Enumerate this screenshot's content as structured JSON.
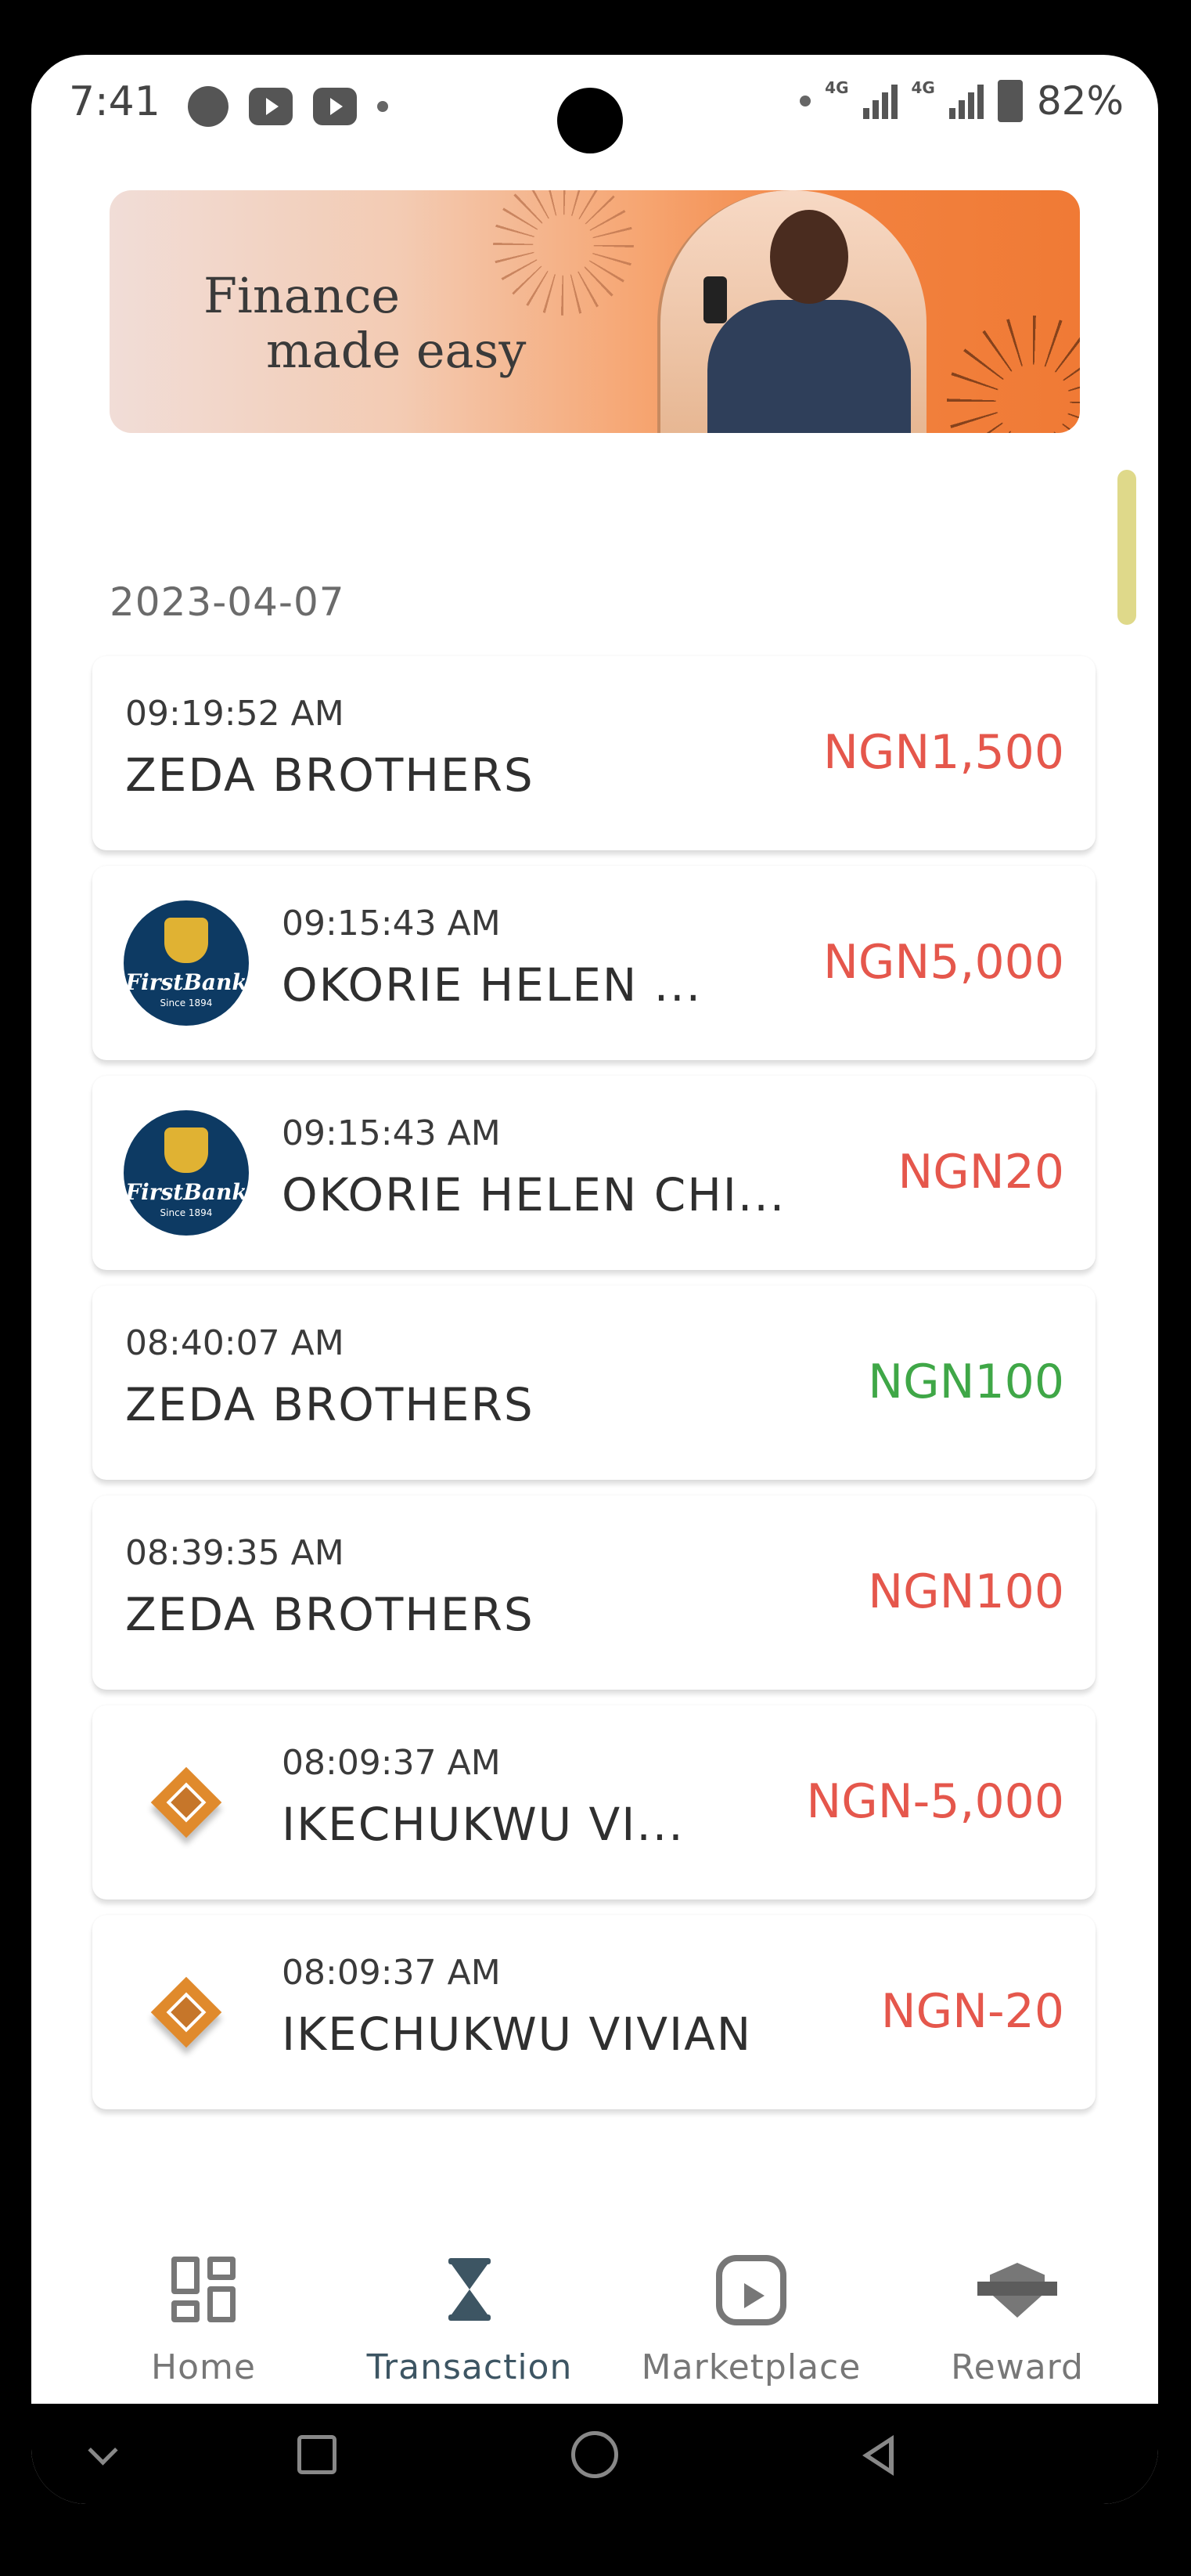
{
  "status_bar": {
    "time": "7:41",
    "network_1": "4G",
    "network_2": "4G",
    "battery": "82%"
  },
  "banner": {
    "line1": "Finance",
    "line2": "made easy"
  },
  "date": "2023-04-07",
  "transactions": [
    {
      "time": "09:19:52 AM",
      "name": "ZEDA BROTHERS",
      "amount": "NGN1,500",
      "status_color": "#e5574c",
      "logo": "none"
    },
    {
      "time": "09:15:43 AM",
      "name": "OKORIE HELEN ...",
      "amount": "NGN5,000",
      "status_color": "#e5574c",
      "logo": "firstbank"
    },
    {
      "time": "09:15:43 AM",
      "name": "OKORIE HELEN CHI...",
      "amount": "NGN20",
      "status_color": "#e5574c",
      "logo": "firstbank"
    },
    {
      "time": "08:40:07 AM",
      "name": "ZEDA BROTHERS",
      "amount": "NGN100",
      "status_color": "#3fa747",
      "logo": "none"
    },
    {
      "time": "08:39:35 AM",
      "name": "ZEDA BROTHERS",
      "amount": "NGN100",
      "status_color": "#e5574c",
      "logo": "none"
    },
    {
      "time": "08:09:37 AM",
      "name": "IKECHUKWU VI...",
      "amount": "NGN-5,000",
      "status_color": "#e5574c",
      "logo": "diamond"
    },
    {
      "time": "08:09:37 AM",
      "name": "IKECHUKWU VIVIAN",
      "amount": "NGN-20",
      "status_color": "#e5574c",
      "logo": "diamond"
    }
  ],
  "firstbank_logo": {
    "name": "FirstBank",
    "since": "Since 1894"
  },
  "bottom_nav": {
    "items": [
      {
        "label": "Home",
        "icon": "grid-icon"
      },
      {
        "label": "Transaction",
        "icon": "hourglass-icon"
      },
      {
        "label": "Marketplace",
        "icon": "play-icon"
      },
      {
        "label": "Reward",
        "icon": "reward-icon"
      }
    ],
    "active_color": "#3d5563"
  }
}
